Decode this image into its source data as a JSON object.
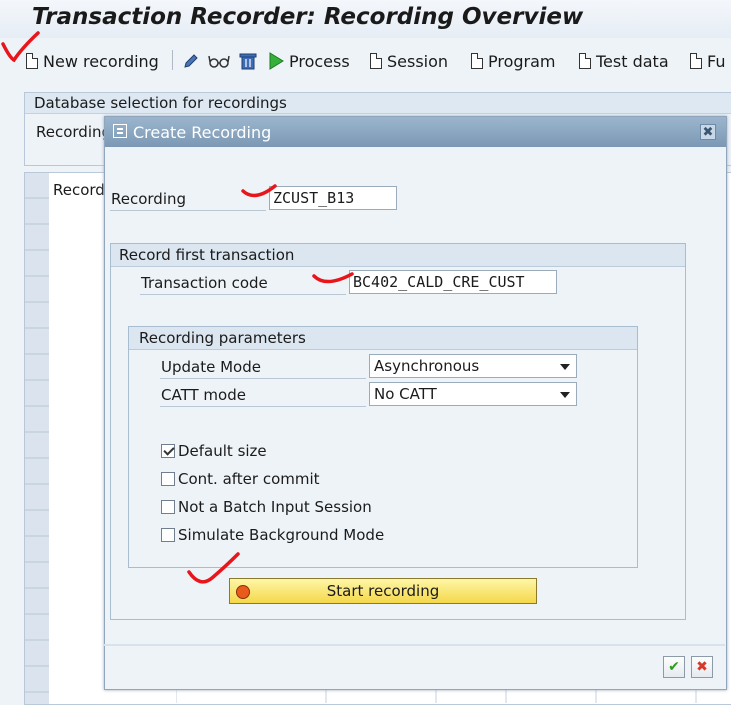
{
  "window": {
    "title": "Transaction Recorder: Recording Overview"
  },
  "toolbar": {
    "new_recording": "New recording",
    "process": "Process",
    "session": "Session",
    "program": "Program",
    "test_data": "Test data",
    "fun_truncated": "Fu"
  },
  "background": {
    "db_selection_header": "Database selection for recordings",
    "recording_label": "Recording",
    "grid_column_header": "Recordi"
  },
  "dialog": {
    "title": "Create Recording",
    "recording_label": "Recording",
    "recording_value": "ZCUST_B13",
    "group_first_transaction": "Record first transaction",
    "tcode_label": "Transaction code",
    "tcode_value": "BC402_CALD_CRE_CUST",
    "group_params": "Recording parameters",
    "update_mode_label": "Update Mode",
    "update_mode_value": "Asynchronous",
    "catt_mode_label": "CATT mode",
    "catt_mode_value": "No CATT",
    "checkboxes": [
      {
        "label": "Default size",
        "checked": true
      },
      {
        "label": "Cont. after commit",
        "checked": false
      },
      {
        "label": "Not a Batch Input Session",
        "checked": false
      },
      {
        "label": "Simulate Background Mode",
        "checked": false
      }
    ],
    "start_button": "Start recording",
    "ok_glyph": "✔",
    "cancel_glyph": "✖",
    "close_glyph": "✖"
  },
  "colors": {
    "annotation_red": "#e8151b",
    "start_button_yellow": "#f4d84a",
    "record_dot": "#e85b1a"
  },
  "icons": [
    "pencil-icon",
    "glasses-icon",
    "trash-icon",
    "play-icon",
    "document-icon",
    "create-recording-icon",
    "close-icon",
    "ok-check-icon",
    "cancel-x-icon",
    "record-dot-icon"
  ]
}
